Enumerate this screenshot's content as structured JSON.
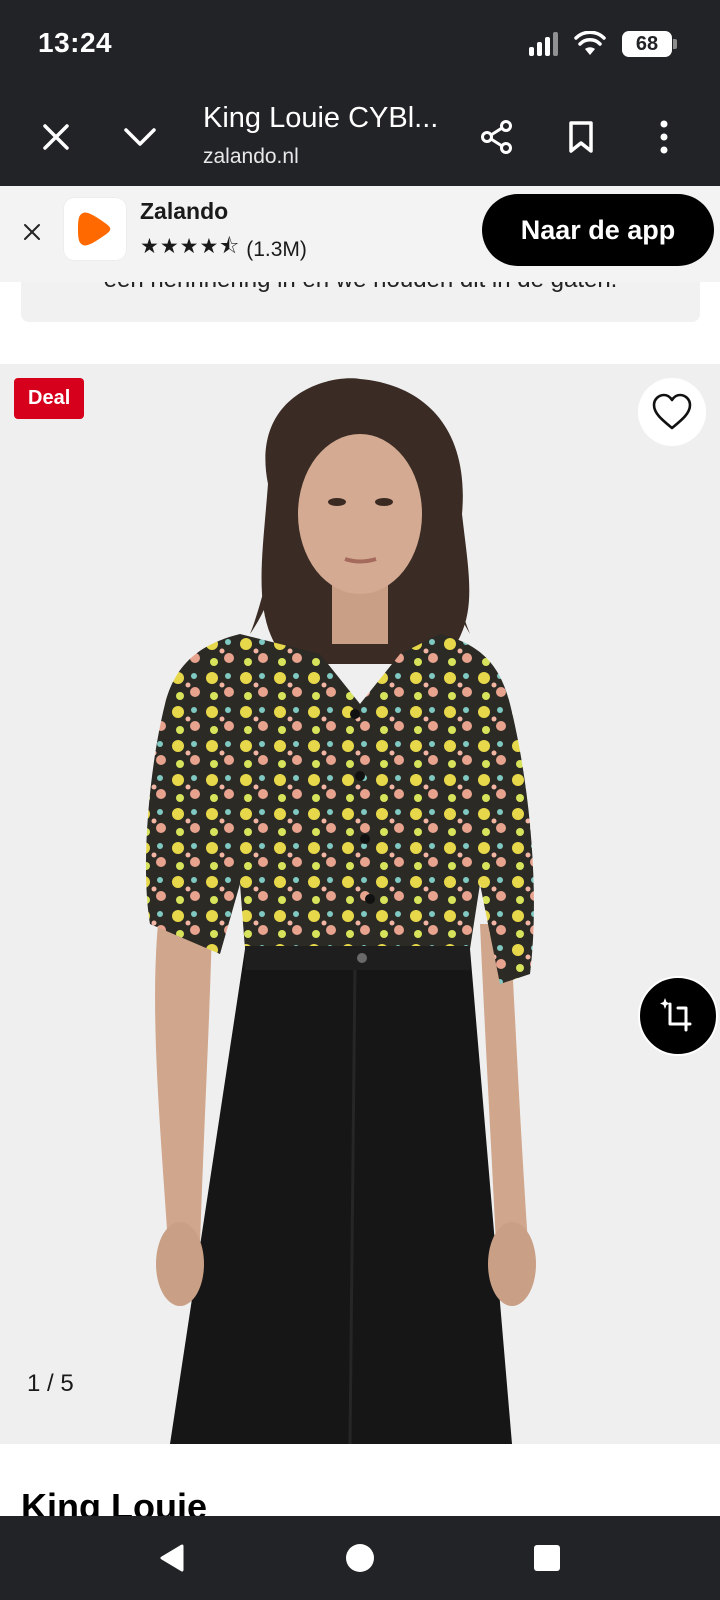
{
  "status_bar": {
    "time": "13:24",
    "battery": "68"
  },
  "browser": {
    "title": "King Louie CYBl...",
    "domain": "zalando.nl"
  },
  "app_banner": {
    "app_name": "Zalando",
    "stars": "★★★★⯪",
    "review_count": "(1.3M)",
    "open_app_label": "Naar de app"
  },
  "info_box": {
    "text": "een herinnering in en we houden dit in de gaten."
  },
  "product": {
    "badge": "Deal",
    "image_counter": "1 / 5",
    "brand": "King Louie"
  },
  "colors": {
    "system_bar": "#222327",
    "deal_red": "#d6001c",
    "zalando_orange": "#ff6900"
  }
}
